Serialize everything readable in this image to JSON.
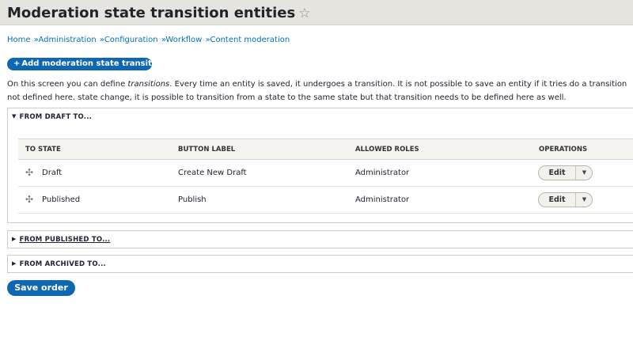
{
  "header": {
    "title": "Moderation state transition entities",
    "star_icon": "☆"
  },
  "breadcrumb": {
    "items": [
      "Home",
      "Administration",
      "Configuration",
      "Workflow",
      "Content moderation"
    ],
    "separator": "»"
  },
  "actions": {
    "add_label": "Add moderation state transition",
    "add_plus": "+"
  },
  "description": {
    "before": "On this screen you can define ",
    "emphasis": "transitions",
    "after": ". Every time an entity is saved, it undergoes a transition. It is not possible to save an entity if it tries do a transition not defined here. state change, it is possible to transition from a state to the same state but that transition needs to be defined here as well."
  },
  "sections": [
    {
      "summary": "FROM DRAFT TO...",
      "expanded": true,
      "table": {
        "columns": [
          "TO STATE",
          "BUTTON LABEL",
          "ALLOWED ROLES",
          "OPERATIONS"
        ],
        "rows": [
          {
            "to_state": "Draft",
            "button_label": "Create New Draft",
            "allowed_roles": "Administrator",
            "operation": "Edit"
          },
          {
            "to_state": "Published",
            "button_label": "Publish",
            "allowed_roles": "Administrator",
            "operation": "Edit"
          }
        ]
      }
    },
    {
      "summary": "FROM PUBLISHED TO...",
      "expanded": false
    },
    {
      "summary": "FROM ARCHIVED TO...",
      "expanded": false
    }
  ],
  "footer": {
    "save_label": "Save order"
  },
  "icons": {
    "expanded": "▼",
    "collapsed": "▶",
    "drag": "✣",
    "dropdown": "▼"
  },
  "colors": {
    "primary_button": "#0e67b0",
    "link": "#0071b8",
    "header_background": "#e6e4df"
  }
}
